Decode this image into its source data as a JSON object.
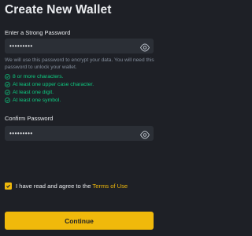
{
  "page": {
    "title": "Create New Wallet"
  },
  "password": {
    "label": "Enter a Strong Password",
    "value": "•••••••••",
    "help": "We will use this password to encrypt your data. You will need this password to unlock your wallet."
  },
  "rules": [
    "8 or more characters.",
    "At least one upper case character.",
    "At least one digit.",
    "At least one symbol."
  ],
  "confirm": {
    "label": "Confirm Password",
    "value": "•••••••••"
  },
  "agreement": {
    "checked": true,
    "text": "I have read and agree to the",
    "link": "Terms of Use"
  },
  "continue_button": {
    "label": "Continue"
  },
  "colors": {
    "background": "#1e2026",
    "input": "#2b2f36",
    "accent": "#f0b90b",
    "success": "#0ecb81",
    "muted": "#848e9c"
  }
}
